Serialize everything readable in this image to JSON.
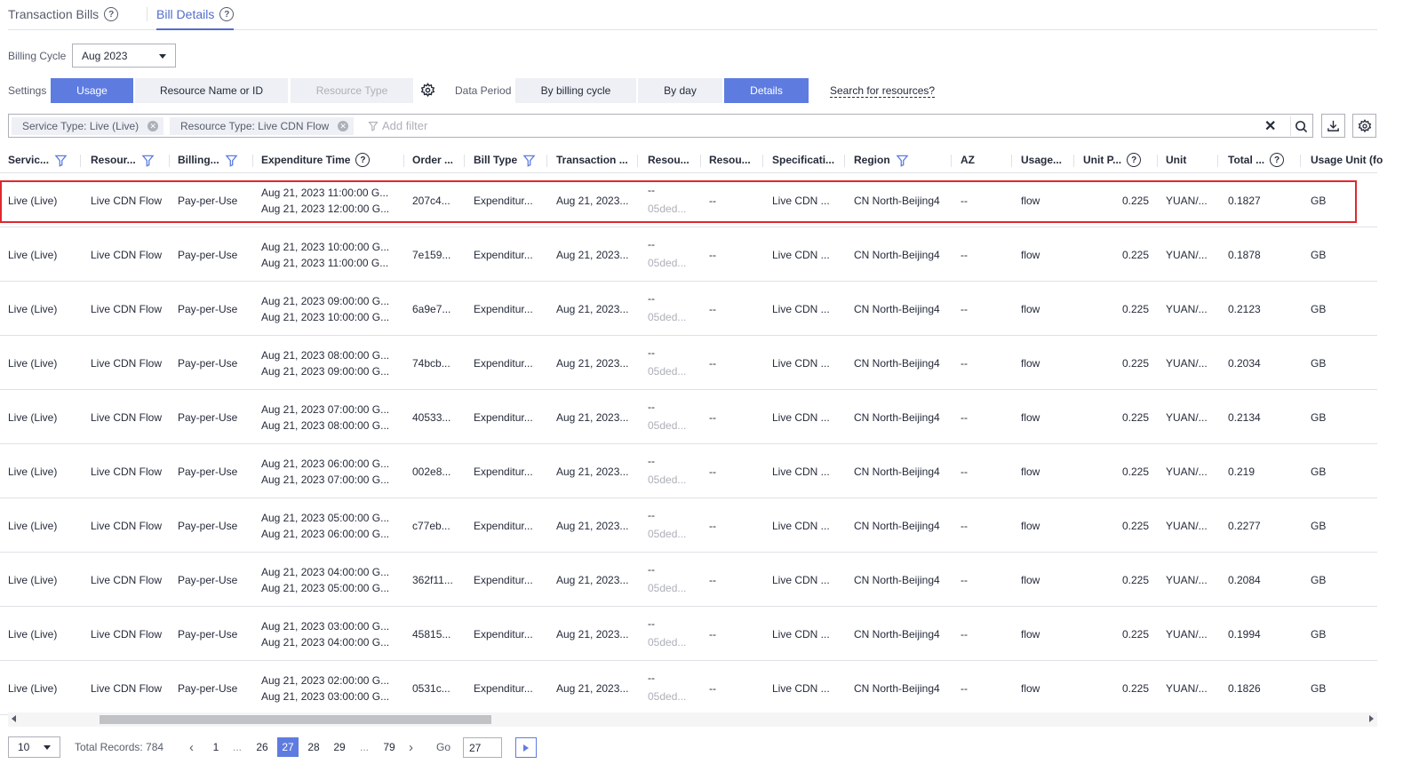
{
  "tabs": [
    {
      "label": "Transaction Bills"
    },
    {
      "label": "Bill Details"
    }
  ],
  "billing_cycle": {
    "label": "Billing Cycle",
    "value": "Aug 2023"
  },
  "settings": {
    "label": "Settings",
    "options": [
      "Usage",
      "Resource Name or ID",
      "Resource Type"
    ],
    "selected": "Usage"
  },
  "data_period": {
    "label": "Data Period",
    "options": [
      "By billing cycle",
      "By day",
      "Details"
    ],
    "selected": "Details"
  },
  "search_link": "Search for resources?",
  "filters": {
    "chips": [
      "Service Type: Live (Live)",
      "Resource Type: Live CDN Flow"
    ],
    "add_placeholder": "Add filter"
  },
  "table": {
    "columns": [
      "Servic...",
      "Resour...",
      "Billing...",
      "Expenditure Time",
      "Order ...",
      "Bill Type",
      "Transaction ...",
      "Resou...",
      "Resou...",
      "Specificati...",
      "Region",
      "AZ",
      "Usage...",
      "Unit P...",
      "Unit",
      "Total ...",
      "Usage Unit (fo"
    ],
    "rows": [
      {
        "service": "Live (Live)",
        "resource": "Live CDN Flow",
        "billing": "Pay-per-Use",
        "time_start": "Aug 21, 2023 11:00:00 G...",
        "time_end": "Aug 21, 2023 12:00:00 G...",
        "order": "207c4...",
        "bill_type": "Expenditur...",
        "transaction": "Aug 21, 2023...",
        "res1": "--",
        "res1_sub": "05ded...",
        "res2": "--",
        "spec": "Live CDN ...",
        "region": "CN North-Beijing4",
        "az": "--",
        "usage": "flow",
        "unit_price": "0.225",
        "unit": "YUAN/...",
        "total": "0.1827",
        "usage_unit": "GB"
      },
      {
        "service": "Live (Live)",
        "resource": "Live CDN Flow",
        "billing": "Pay-per-Use",
        "time_start": "Aug 21, 2023 10:00:00 G...",
        "time_end": "Aug 21, 2023 11:00:00 G...",
        "order": "7e159...",
        "bill_type": "Expenditur...",
        "transaction": "Aug 21, 2023...",
        "res1": "--",
        "res1_sub": "05ded...",
        "res2": "--",
        "spec": "Live CDN ...",
        "region": "CN North-Beijing4",
        "az": "--",
        "usage": "flow",
        "unit_price": "0.225",
        "unit": "YUAN/...",
        "total": "0.1878",
        "usage_unit": "GB"
      },
      {
        "service": "Live (Live)",
        "resource": "Live CDN Flow",
        "billing": "Pay-per-Use",
        "time_start": "Aug 21, 2023 09:00:00 G...",
        "time_end": "Aug 21, 2023 10:00:00 G...",
        "order": "6a9e7...",
        "bill_type": "Expenditur...",
        "transaction": "Aug 21, 2023...",
        "res1": "--",
        "res1_sub": "05ded...",
        "res2": "--",
        "spec": "Live CDN ...",
        "region": "CN North-Beijing4",
        "az": "--",
        "usage": "flow",
        "unit_price": "0.225",
        "unit": "YUAN/...",
        "total": "0.2123",
        "usage_unit": "GB"
      },
      {
        "service": "Live (Live)",
        "resource": "Live CDN Flow",
        "billing": "Pay-per-Use",
        "time_start": "Aug 21, 2023 08:00:00 G...",
        "time_end": "Aug 21, 2023 09:00:00 G...",
        "order": "74bcb...",
        "bill_type": "Expenditur...",
        "transaction": "Aug 21, 2023...",
        "res1": "--",
        "res1_sub": "05ded...",
        "res2": "--",
        "spec": "Live CDN ...",
        "region": "CN North-Beijing4",
        "az": "--",
        "usage": "flow",
        "unit_price": "0.225",
        "unit": "YUAN/...",
        "total": "0.2034",
        "usage_unit": "GB"
      },
      {
        "service": "Live (Live)",
        "resource": "Live CDN Flow",
        "billing": "Pay-per-Use",
        "time_start": "Aug 21, 2023 07:00:00 G...",
        "time_end": "Aug 21, 2023 08:00:00 G...",
        "order": "40533...",
        "bill_type": "Expenditur...",
        "transaction": "Aug 21, 2023...",
        "res1": "--",
        "res1_sub": "05ded...",
        "res2": "--",
        "spec": "Live CDN ...",
        "region": "CN North-Beijing4",
        "az": "--",
        "usage": "flow",
        "unit_price": "0.225",
        "unit": "YUAN/...",
        "total": "0.2134",
        "usage_unit": "GB"
      },
      {
        "service": "Live (Live)",
        "resource": "Live CDN Flow",
        "billing": "Pay-per-Use",
        "time_start": "Aug 21, 2023 06:00:00 G...",
        "time_end": "Aug 21, 2023 07:00:00 G...",
        "order": "002e8...",
        "bill_type": "Expenditur...",
        "transaction": "Aug 21, 2023...",
        "res1": "--",
        "res1_sub": "05ded...",
        "res2": "--",
        "spec": "Live CDN ...",
        "region": "CN North-Beijing4",
        "az": "--",
        "usage": "flow",
        "unit_price": "0.225",
        "unit": "YUAN/...",
        "total": "0.219",
        "usage_unit": "GB"
      },
      {
        "service": "Live (Live)",
        "resource": "Live CDN Flow",
        "billing": "Pay-per-Use",
        "time_start": "Aug 21, 2023 05:00:00 G...",
        "time_end": "Aug 21, 2023 06:00:00 G...",
        "order": "c77eb...",
        "bill_type": "Expenditur...",
        "transaction": "Aug 21, 2023...",
        "res1": "--",
        "res1_sub": "05ded...",
        "res2": "--",
        "spec": "Live CDN ...",
        "region": "CN North-Beijing4",
        "az": "--",
        "usage": "flow",
        "unit_price": "0.225",
        "unit": "YUAN/...",
        "total": "0.2277",
        "usage_unit": "GB"
      },
      {
        "service": "Live (Live)",
        "resource": "Live CDN Flow",
        "billing": "Pay-per-Use",
        "time_start": "Aug 21, 2023 04:00:00 G...",
        "time_end": "Aug 21, 2023 05:00:00 G...",
        "order": "362f11...",
        "bill_type": "Expenditur...",
        "transaction": "Aug 21, 2023...",
        "res1": "--",
        "res1_sub": "05ded...",
        "res2": "--",
        "spec": "Live CDN ...",
        "region": "CN North-Beijing4",
        "az": "--",
        "usage": "flow",
        "unit_price": "0.225",
        "unit": "YUAN/...",
        "total": "0.2084",
        "usage_unit": "GB"
      },
      {
        "service": "Live (Live)",
        "resource": "Live CDN Flow",
        "billing": "Pay-per-Use",
        "time_start": "Aug 21, 2023 03:00:00 G...",
        "time_end": "Aug 21, 2023 04:00:00 G...",
        "order": "45815...",
        "bill_type": "Expenditur...",
        "transaction": "Aug 21, 2023...",
        "res1": "--",
        "res1_sub": "05ded...",
        "res2": "--",
        "spec": "Live CDN ...",
        "region": "CN North-Beijing4",
        "az": "--",
        "usage": "flow",
        "unit_price": "0.225",
        "unit": "YUAN/...",
        "total": "0.1994",
        "usage_unit": "GB"
      },
      {
        "service": "Live (Live)",
        "resource": "Live CDN Flow",
        "billing": "Pay-per-Use",
        "time_start": "Aug 21, 2023 02:00:00 G...",
        "time_end": "Aug 21, 2023 03:00:00 G...",
        "order": "0531c...",
        "bill_type": "Expenditur...",
        "transaction": "Aug 21, 2023...",
        "res1": "--",
        "res1_sub": "05ded...",
        "res2": "--",
        "spec": "Live CDN ...",
        "region": "CN North-Beijing4",
        "az": "--",
        "usage": "flow",
        "unit_price": "0.225",
        "unit": "YUAN/...",
        "total": "0.1826",
        "usage_unit": "GB"
      }
    ]
  },
  "pagination": {
    "page_size": "10",
    "total_records": "Total Records: 784",
    "pages": [
      "1",
      "...",
      "26",
      "27",
      "28",
      "29",
      "...",
      "79"
    ],
    "current_page": "27",
    "go_label": "Go",
    "go_value": "27"
  },
  "colors": {
    "accent": "#5e7ce0",
    "highlight_border": "#e0282e",
    "tab_active": "#526ecc"
  }
}
